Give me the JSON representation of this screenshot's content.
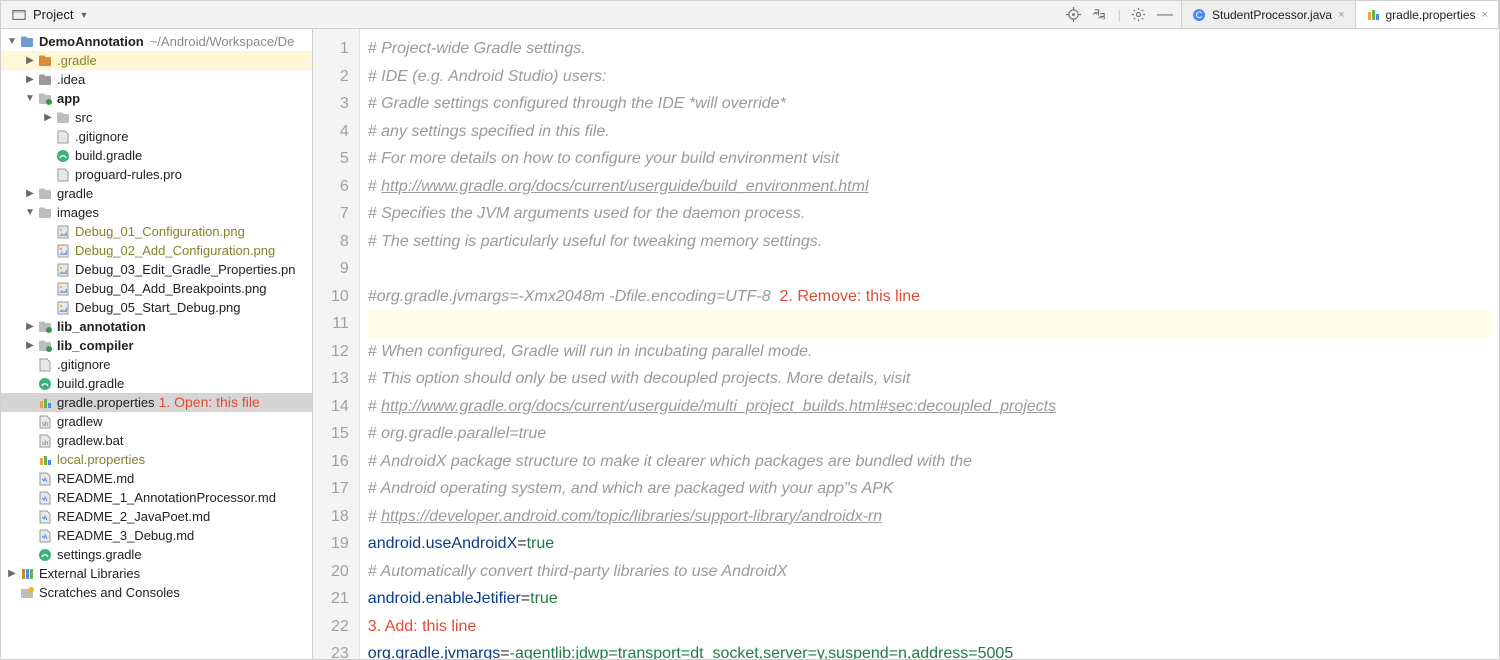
{
  "toolbar": {
    "project_header": "Project"
  },
  "icons": {
    "target": "target-icon",
    "collapse": "collapse-all-icon",
    "gear": "gear-icon",
    "hide": "hide-icon"
  },
  "tabs": [
    {
      "label": "StudentProcessor.java",
      "active": false,
      "icon": "class"
    },
    {
      "label": "gradle.properties",
      "active": true,
      "icon": "props"
    }
  ],
  "tree": [
    {
      "d": 0,
      "ar": "open",
      "ic": "project",
      "t": "DemoAnnotation",
      "bold": true,
      "suffix": "~/Android/Workspace/De",
      "sufGray": true
    },
    {
      "d": 1,
      "ar": "closed",
      "ic": "folder-ex",
      "t": ".gradle",
      "olive": true,
      "hl": "yel"
    },
    {
      "d": 1,
      "ar": "closed",
      "ic": "folder-mod",
      "t": ".idea"
    },
    {
      "d": 1,
      "ar": "open",
      "ic": "module",
      "t": "app",
      "bold": true
    },
    {
      "d": 2,
      "ar": "closed",
      "ic": "folder",
      "t": "src"
    },
    {
      "d": 2,
      "ar": "",
      "ic": "file",
      "t": ".gitignore"
    },
    {
      "d": 2,
      "ar": "",
      "ic": "gradle",
      "t": "build.gradle"
    },
    {
      "d": 2,
      "ar": "",
      "ic": "file",
      "t": "proguard-rules.pro"
    },
    {
      "d": 1,
      "ar": "closed",
      "ic": "folder",
      "t": "gradle"
    },
    {
      "d": 1,
      "ar": "open",
      "ic": "folder",
      "t": "images"
    },
    {
      "d": 2,
      "ar": "",
      "ic": "png",
      "t": "Debug_01_Configuration.png",
      "olive": true
    },
    {
      "d": 2,
      "ar": "",
      "ic": "png",
      "t": "Debug_02_Add_Configuration.png",
      "olive": true
    },
    {
      "d": 2,
      "ar": "",
      "ic": "png",
      "t": "Debug_03_Edit_Gradle_Properties.pn"
    },
    {
      "d": 2,
      "ar": "",
      "ic": "png",
      "t": "Debug_04_Add_Breakpoints.png"
    },
    {
      "d": 2,
      "ar": "",
      "ic": "png",
      "t": "Debug_05_Start_Debug.png"
    },
    {
      "d": 1,
      "ar": "closed",
      "ic": "module",
      "t": "lib_annotation",
      "bold": true
    },
    {
      "d": 1,
      "ar": "closed",
      "ic": "module",
      "t": "lib_compiler",
      "bold": true
    },
    {
      "d": 1,
      "ar": "",
      "ic": "file",
      "t": ".gitignore"
    },
    {
      "d": 1,
      "ar": "",
      "ic": "gradle",
      "t": "build.gradle"
    },
    {
      "d": 1,
      "ar": "",
      "ic": "props",
      "t": "gradle.properties",
      "hl": "sel",
      "ann": "1. Open: this file"
    },
    {
      "d": 1,
      "ar": "",
      "ic": "sh",
      "t": "gradlew"
    },
    {
      "d": 1,
      "ar": "",
      "ic": "sh",
      "t": "gradlew.bat"
    },
    {
      "d": 1,
      "ar": "",
      "ic": "props",
      "t": "local.properties",
      "olive": true
    },
    {
      "d": 1,
      "ar": "",
      "ic": "md",
      "t": "README.md"
    },
    {
      "d": 1,
      "ar": "",
      "ic": "md",
      "t": "README_1_AnnotationProcessor.md"
    },
    {
      "d": 1,
      "ar": "",
      "ic": "md",
      "t": "README_2_JavaPoet.md"
    },
    {
      "d": 1,
      "ar": "",
      "ic": "md",
      "t": "README_3_Debug.md"
    },
    {
      "d": 1,
      "ar": "",
      "ic": "gradle",
      "t": "settings.gradle"
    },
    {
      "d": 0,
      "ar": "closed",
      "ic": "libs",
      "t": "External Libraries"
    },
    {
      "d": 0,
      "ar": "",
      "ic": "scratch",
      "t": "Scratches and Consoles"
    }
  ],
  "editor": {
    "lines": [
      {
        "n": 1,
        "seg": [
          {
            "c": "cm",
            "t": "# Project-wide Gradle settings."
          }
        ]
      },
      {
        "n": 2,
        "seg": [
          {
            "c": "cm",
            "t": "# IDE (e.g. Android Studio) users:"
          }
        ]
      },
      {
        "n": 3,
        "seg": [
          {
            "c": "cm",
            "t": "# Gradle settings configured through the IDE *will override*"
          }
        ]
      },
      {
        "n": 4,
        "seg": [
          {
            "c": "cm",
            "t": "# any settings specified in this file."
          }
        ]
      },
      {
        "n": 5,
        "seg": [
          {
            "c": "cm",
            "t": "# For more details on how to configure your build environment visit"
          }
        ]
      },
      {
        "n": 6,
        "seg": [
          {
            "c": "cm",
            "t": "# "
          },
          {
            "c": "cm cm-u",
            "t": "http://www.gradle.org/docs/current/userguide/build_environment.html"
          }
        ]
      },
      {
        "n": 7,
        "seg": [
          {
            "c": "cm",
            "t": "# Specifies the JVM arguments used for the daemon process."
          }
        ]
      },
      {
        "n": 8,
        "seg": [
          {
            "c": "cm",
            "t": "# The setting is particularly useful for tweaking memory settings."
          }
        ]
      },
      {
        "n": 9,
        "seg": [
          {
            "c": "cm",
            "t": " "
          }
        ]
      },
      {
        "n": 10,
        "seg": [
          {
            "c": "cm",
            "t": "#org.gradle.jvmargs=-Xmx2048m -Dfile.encoding=UTF-8"
          },
          {
            "c": "plain",
            "t": "  "
          },
          {
            "c": "ann2",
            "t": "2. Remove: this line"
          }
        ]
      },
      {
        "n": 11,
        "cur": true,
        "seg": [
          {
            "c": "",
            "t": ""
          }
        ]
      },
      {
        "n": 12,
        "seg": [
          {
            "c": "cm",
            "t": "# When configured, Gradle will run in incubating parallel mode."
          }
        ]
      },
      {
        "n": 13,
        "seg": [
          {
            "c": "cm",
            "t": "# This option should only be used with decoupled projects. More details, visit"
          }
        ]
      },
      {
        "n": 14,
        "seg": [
          {
            "c": "cm",
            "t": "# "
          },
          {
            "c": "cm cm-u",
            "t": "http://www.gradle.org/docs/current/userguide/multi_project_builds.html#sec:decoupled_projects"
          }
        ]
      },
      {
        "n": 15,
        "seg": [
          {
            "c": "cm",
            "t": "# org.gradle.parallel=true"
          }
        ]
      },
      {
        "n": 16,
        "seg": [
          {
            "c": "cm",
            "t": "# AndroidX package structure to make it clearer which packages are bundled with the"
          }
        ]
      },
      {
        "n": 17,
        "seg": [
          {
            "c": "cm",
            "t": "# Android operating system, and which are packaged with your app\"s APK"
          }
        ]
      },
      {
        "n": 18,
        "seg": [
          {
            "c": "cm",
            "t": "# "
          },
          {
            "c": "cm cm-u",
            "t": "https://developer.android.com/topic/libraries/support-library/androidx-rn"
          }
        ]
      },
      {
        "n": 19,
        "seg": [
          {
            "c": "key",
            "t": "android.useAndroidX"
          },
          {
            "c": "plain",
            "t": "="
          },
          {
            "c": "val",
            "t": "true"
          }
        ]
      },
      {
        "n": 20,
        "seg": [
          {
            "c": "cm",
            "t": "# Automatically convert third-party libraries to use AndroidX"
          }
        ]
      },
      {
        "n": 21,
        "seg": [
          {
            "c": "key",
            "t": "android.enableJetifier"
          },
          {
            "c": "plain",
            "t": "="
          },
          {
            "c": "val",
            "t": "true"
          }
        ]
      },
      {
        "n": 22,
        "seg": [
          {
            "c": "ann2",
            "t": "3. Add: this line"
          }
        ]
      },
      {
        "n": 23,
        "seg": [
          {
            "c": "key",
            "t": "org.gradle.jvmargs"
          },
          {
            "c": "plain",
            "t": "="
          },
          {
            "c": "arg",
            "t": "-agentlib:jdwp=transport=dt_socket,server=y,suspend=n,address=5005"
          }
        ]
      }
    ]
  }
}
